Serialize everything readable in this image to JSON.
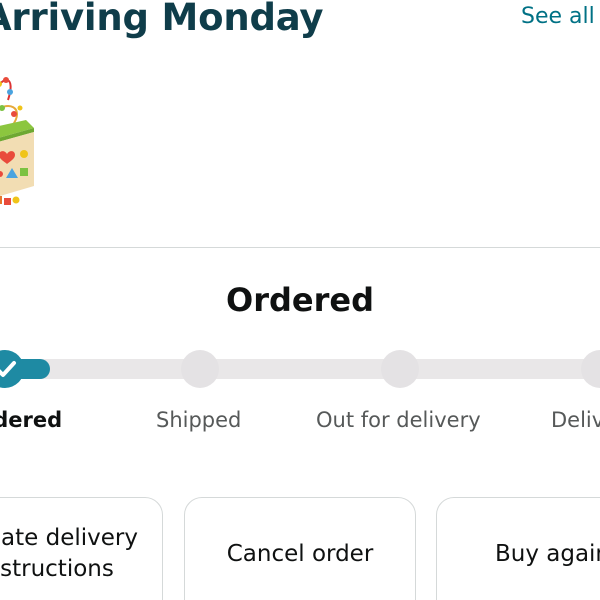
{
  "header": {
    "title": "Arriving Monday",
    "see_all_label": "See all"
  },
  "order_status": {
    "title": "Ordered",
    "progress_fraction": 0.0,
    "steps": [
      {
        "label": "Ordered",
        "state": "complete"
      },
      {
        "label": "Shipped",
        "state": "pending"
      },
      {
        "label": "Out for delivery",
        "state": "pending"
      },
      {
        "label": "Delivered",
        "state": "pending"
      }
    ]
  },
  "actions": [
    {
      "label": "Update delivery\ninstructions"
    },
    {
      "label": "Cancel order"
    },
    {
      "label": "Buy again"
    }
  ],
  "colors": {
    "accent": "#1e8aa3",
    "link": "#007185",
    "title": "#0f3d4a",
    "track": "#e9e7e8"
  },
  "icons": {
    "product": "wooden-activity-cube-image",
    "step_done": "checkmark-icon"
  }
}
